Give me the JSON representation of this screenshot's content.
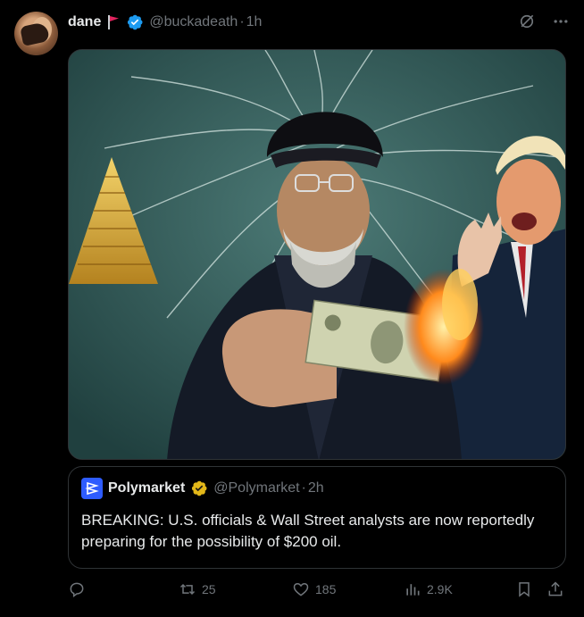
{
  "author": {
    "display_name": "dane",
    "handle": "@buckadeath",
    "separator": "·",
    "time": "1h"
  },
  "media": {
    "alt": "Illustration of a cleric burning a dollar bill beside gold bars and a shouting man in a suit"
  },
  "quote": {
    "display_name": "Polymarket",
    "handle": "@Polymarket",
    "separator": "·",
    "time": "2h",
    "text": "BREAKING: U.S. officials & Wall Street analysts are now reportedly preparing for the possibility of $200 oil."
  },
  "actions": {
    "retweets": "25",
    "likes": "185",
    "views": "2.9K"
  },
  "colors": {
    "background": "#000000",
    "text": "#e7e9ea",
    "muted": "#71767b",
    "verified_blue": "#1d9bf0",
    "verified_gold": "#e2b719",
    "polymarket_blue": "#2e5cff",
    "flag_red": "#e0245e"
  }
}
